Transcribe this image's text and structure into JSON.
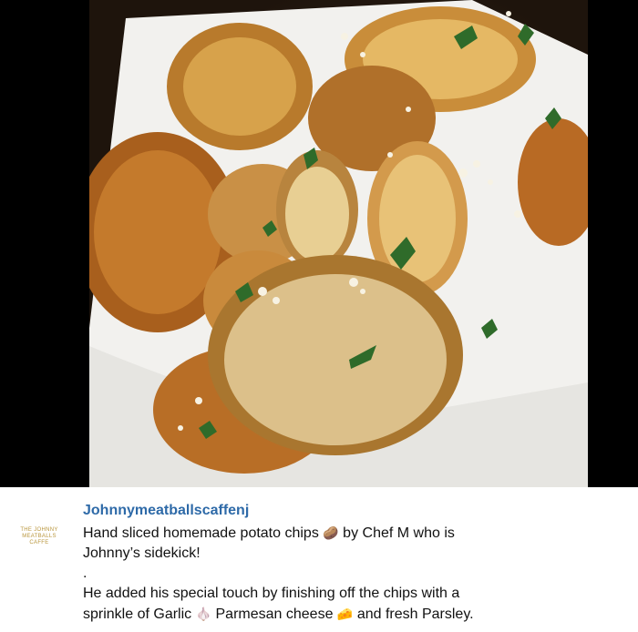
{
  "post": {
    "username": "Johnnymeatballscaffenj",
    "avatar_text": [
      "THE JOHNNY",
      "MEATBALLS",
      "CAFFE"
    ],
    "caption": {
      "line1_a": "Hand sliced homemade potato chips",
      "line1_emoji": "🥔",
      "line1_b": "by Chef M who is",
      "line2": "Johnny’s sidekick!",
      "line3": ".",
      "line4": "He added his special touch by finishing off the chips with a",
      "line5_a": "sprinkle of Garlic",
      "line5_emoji_garlic": "🧄",
      "line5_b": "Parmesan cheese",
      "line5_emoji_cheese": "🧀",
      "line5_c": "and fresh Parsley."
    }
  },
  "colors": {
    "username": "#2e6aa8",
    "avatar_text": "#b8953b",
    "photo_letterbox": "#000000"
  }
}
